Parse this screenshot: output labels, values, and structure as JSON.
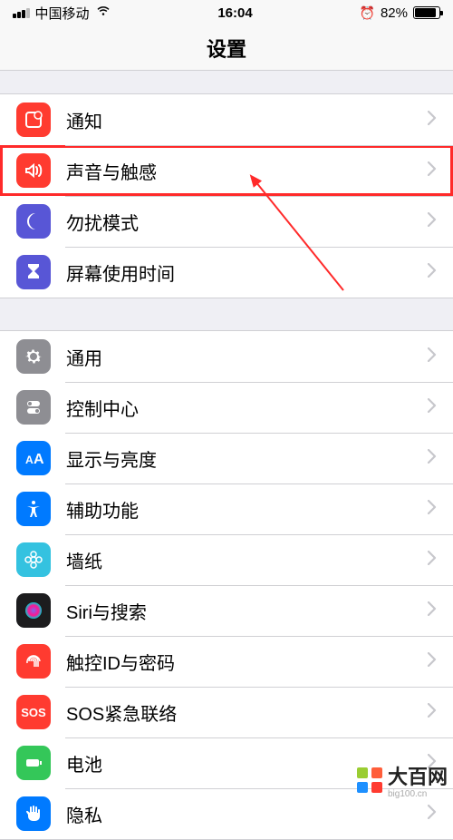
{
  "status": {
    "carrier": "中国移动",
    "time": "16:04",
    "battery_pct": "82%"
  },
  "nav": {
    "title": "设置"
  },
  "groups": [
    {
      "items": [
        {
          "key": "notifications",
          "label": "通知",
          "icon": "notification-icon",
          "color": "#ff3b30"
        },
        {
          "key": "sound",
          "label": "声音与触感",
          "icon": "sound-icon",
          "color": "#ff3b30",
          "highlighted": true
        },
        {
          "key": "dnd",
          "label": "勿扰模式",
          "icon": "moon-icon",
          "color": "#5856d6"
        },
        {
          "key": "screentime",
          "label": "屏幕使用时间",
          "icon": "hourglass-icon",
          "color": "#5856d6"
        }
      ]
    },
    {
      "items": [
        {
          "key": "general",
          "label": "通用",
          "icon": "gear-icon",
          "color": "#8e8e93"
        },
        {
          "key": "control",
          "label": "控制中心",
          "icon": "switches-icon",
          "color": "#8e8e93"
        },
        {
          "key": "display",
          "label": "显示与亮度",
          "icon": "text-size-icon",
          "color": "#007aff"
        },
        {
          "key": "accessibility",
          "label": "辅助功能",
          "icon": "accessibility-icon",
          "color": "#007aff"
        },
        {
          "key": "wallpaper",
          "label": "墙纸",
          "icon": "flower-icon",
          "color": "#34c2e0"
        },
        {
          "key": "siri",
          "label": "Siri与搜索",
          "icon": "siri-icon",
          "color": "#1c1c1e"
        },
        {
          "key": "touchid",
          "label": "触控ID与密码",
          "icon": "fingerprint-icon",
          "color": "#ff3b30"
        },
        {
          "key": "sos",
          "label": "SOS紧急联络",
          "icon": "sos-icon",
          "color": "#ff3b30",
          "text_icon": "SOS"
        },
        {
          "key": "battery",
          "label": "电池",
          "icon": "battery-icon",
          "color": "#34c759"
        },
        {
          "key": "privacy",
          "label": "隐私",
          "icon": "hand-icon",
          "color": "#007aff"
        }
      ]
    }
  ],
  "watermark": {
    "brand": "大百网",
    "url": "big100.cn"
  }
}
